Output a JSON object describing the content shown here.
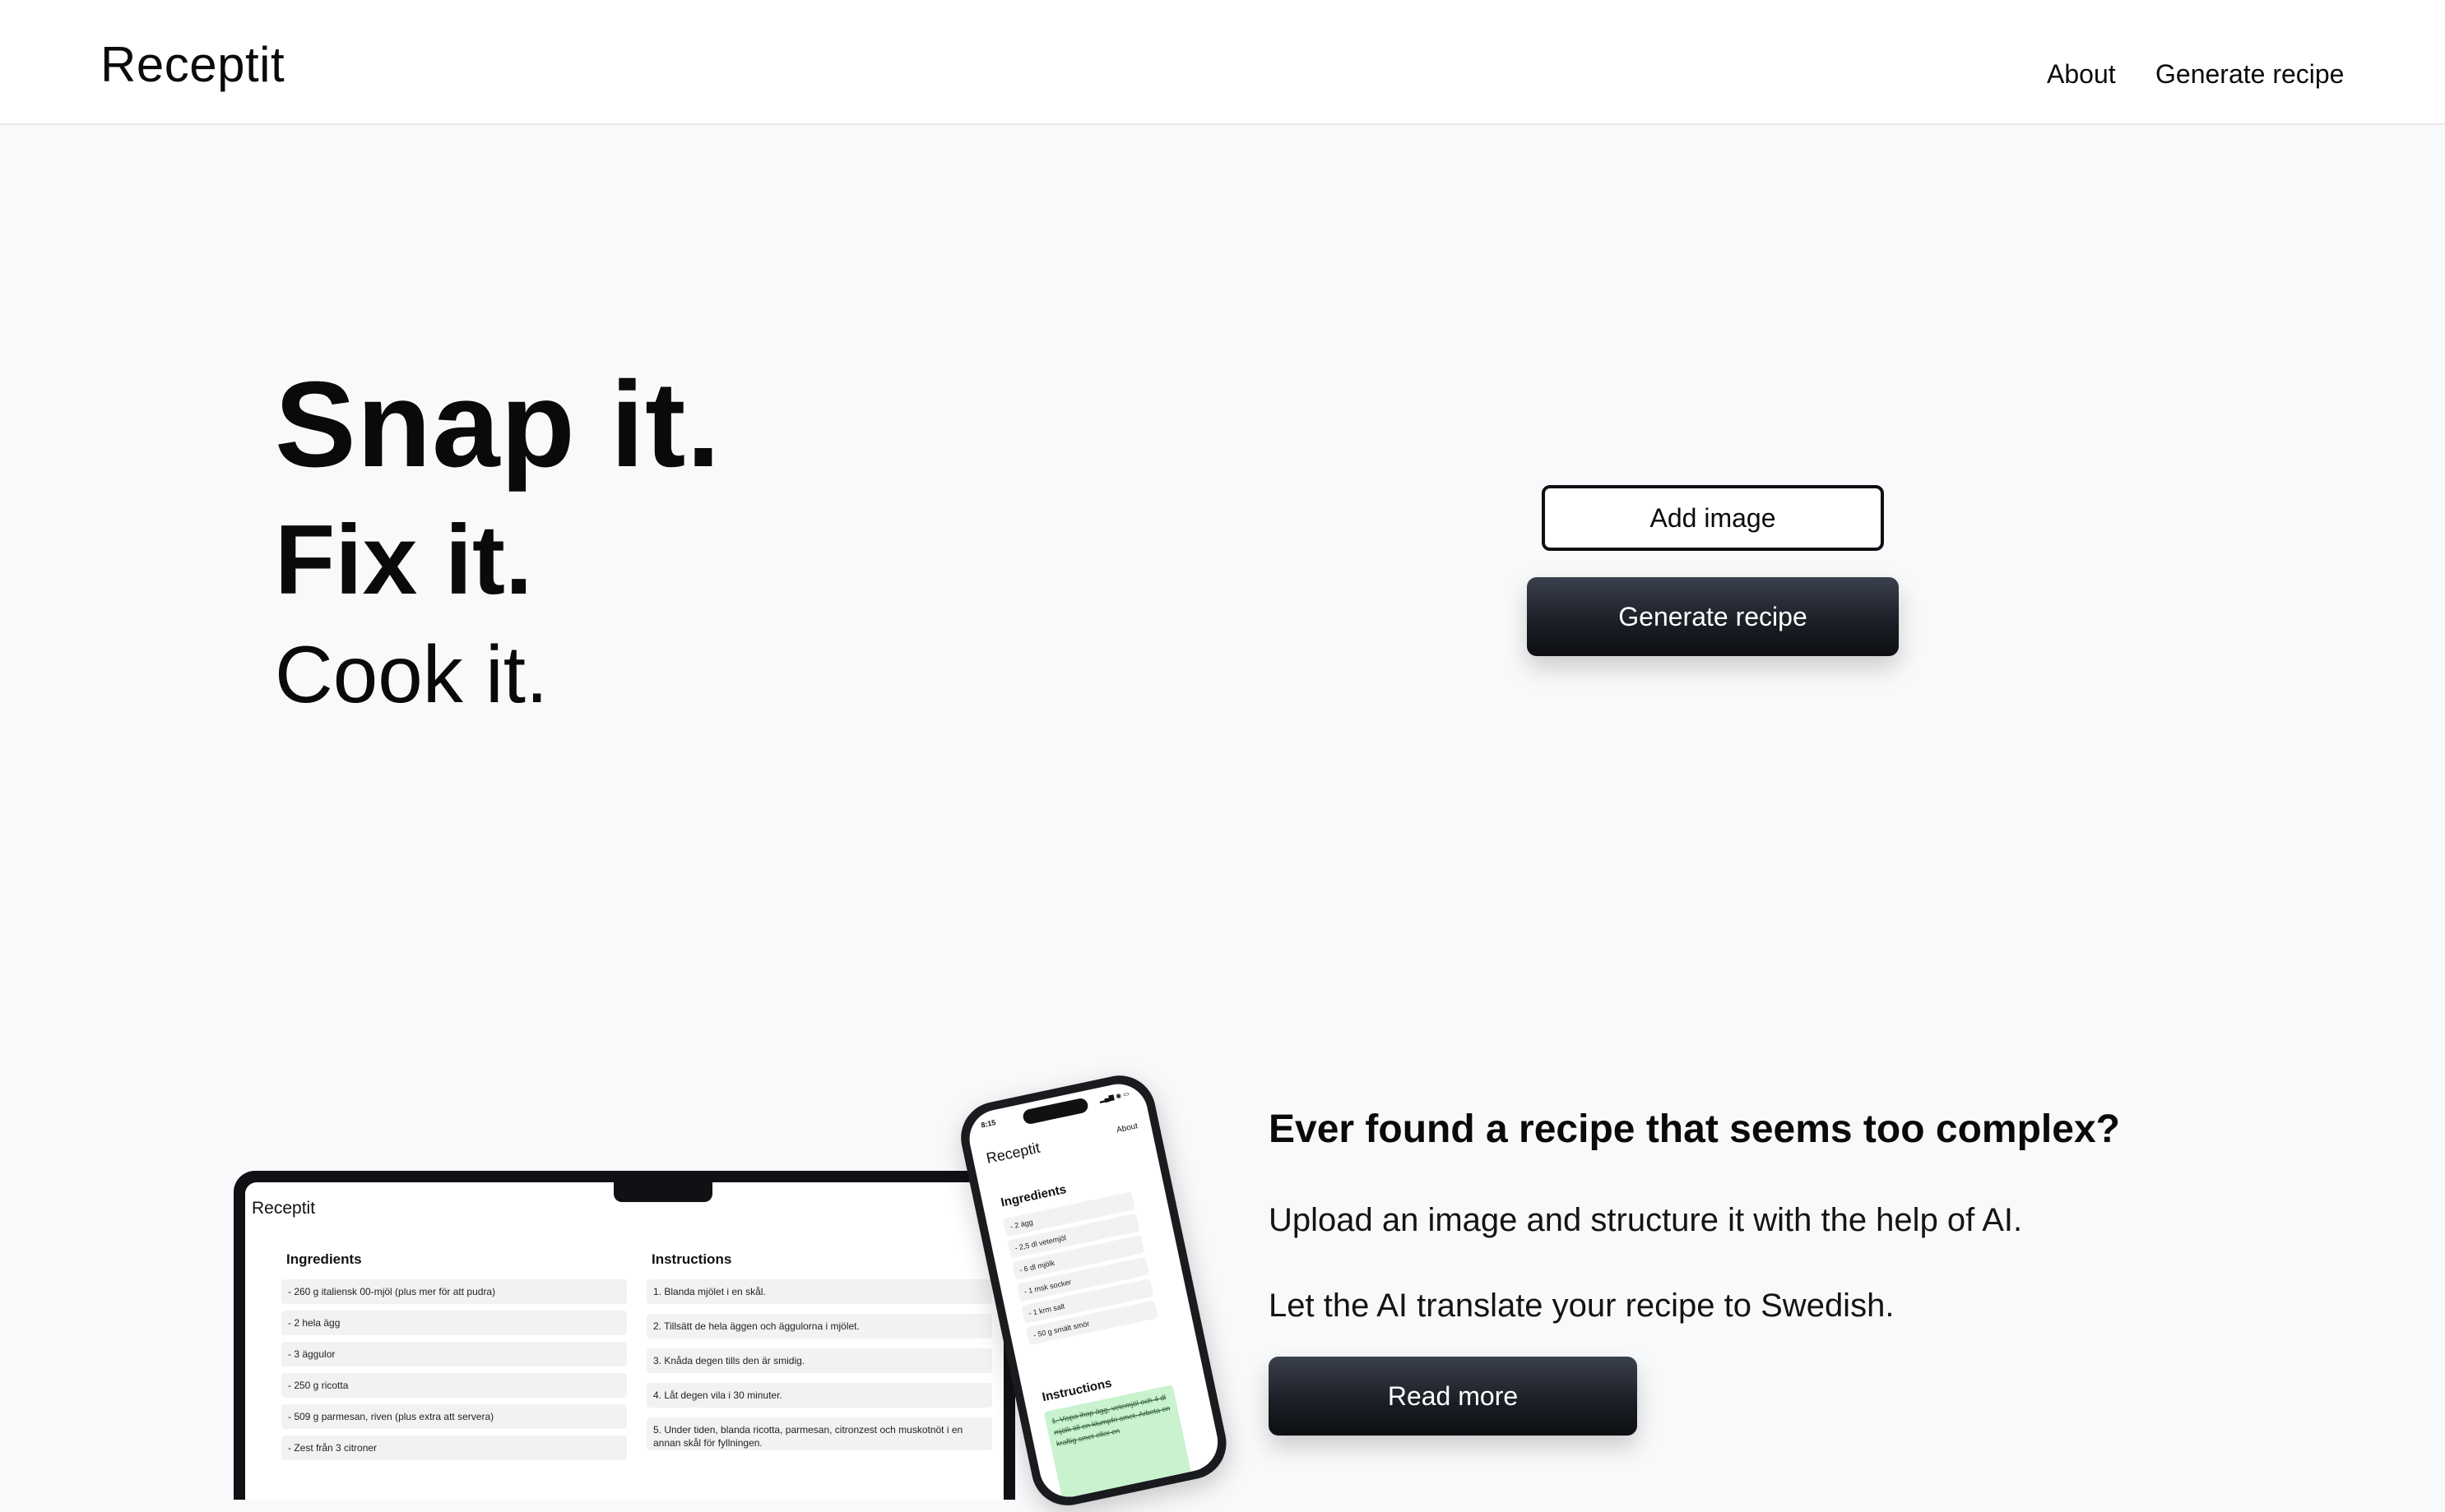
{
  "header": {
    "brand": "Receptit",
    "nav": {
      "about": "About",
      "generate": "Generate recipe"
    }
  },
  "hero": {
    "line1": "Snap it.",
    "line2": "Fix it.",
    "line3": "Cook it.",
    "add_image_label": "Add image",
    "generate_label": "Generate recipe"
  },
  "info": {
    "title": "Ever found a recipe that seems too complex?",
    "text1": "Upload an image and structure it with the help of AI.",
    "text2": "Let the AI translate your recipe to Swedish.",
    "read_more_label": "Read more"
  },
  "laptop_preview": {
    "brand": "Receptit",
    "ingredients_title": "Ingredients",
    "instructions_title": "Instructions",
    "ingredients": [
      "- 260 g italiensk 00-mjöl (plus mer för att pudra)",
      "- 2 hela ägg",
      "- 3 äggulor",
      "- 250 g ricotta",
      "- 509 g parmesan, riven (plus extra att servera)",
      "- Zest från 3 citroner"
    ],
    "instructions": [
      "1. Blanda mjölet i en skål.",
      "2. Tillsätt de hela äggen och äggulorna i mjölet.",
      "3. Knåda degen tills den är smidig.",
      "4. Låt degen vila i 30 minuter.",
      "5. Under tiden, blanda ricotta, parmesan, citronzest och muskotnöt i en annan skål för fyllningen."
    ]
  },
  "phone_preview": {
    "time": "8:15",
    "status": "▂▄▆ ◉ ▭",
    "brand": "Receptit",
    "about": "About",
    "ingredients_title": "Ingredients",
    "ingredients": [
      "- 2 ägg",
      "- 2,5 dl vetemjöl",
      "- 6 dl mjölk",
      "- 1 msk socker",
      "- 1 krm salt",
      "- 50 g smält smör"
    ],
    "instructions_title": "Instructions",
    "step": "1. Vispa ihop ägg, vetemjöl och 4 dl mjölk till en klumpfri smet. Arbeta en kraftig smet eller en"
  }
}
